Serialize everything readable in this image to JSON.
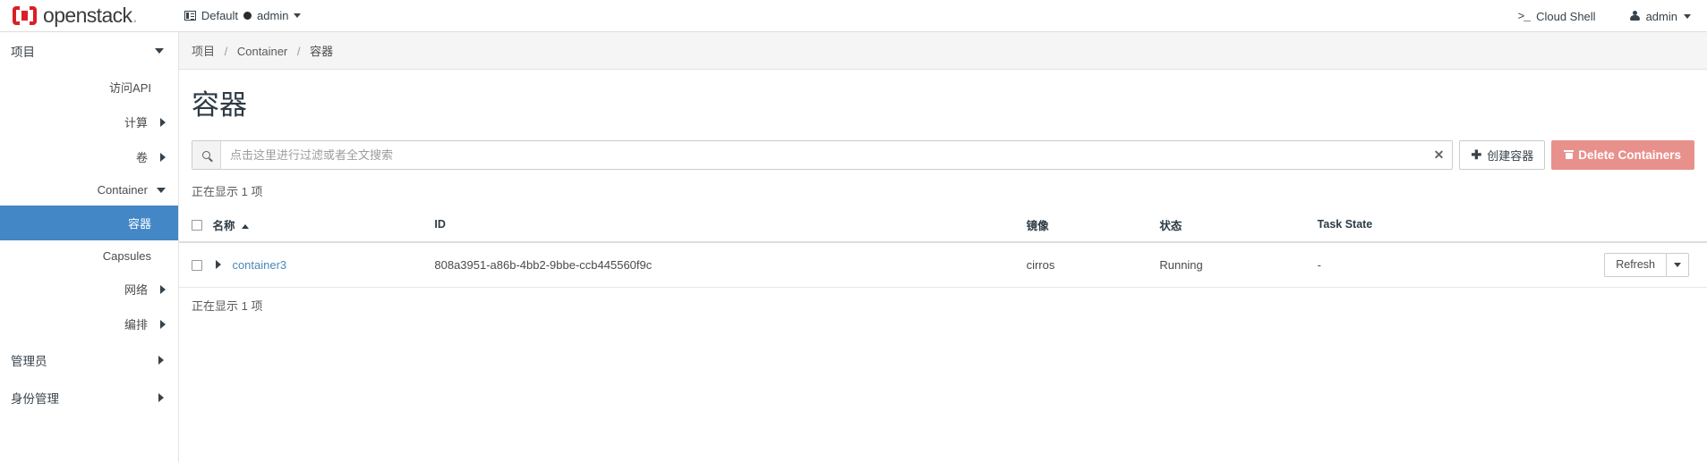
{
  "brand": {
    "word": "openstack",
    "dot": "."
  },
  "navbar": {
    "context": {
      "domain": "Default",
      "project": "admin",
      "icon": "list-icon"
    },
    "cloud_shell": {
      "label": "Cloud Shell",
      "icon": "terminal-prompt-icon",
      "glyph": ">_"
    },
    "user": {
      "label": "admin",
      "icon": "user-icon"
    }
  },
  "sidebar": {
    "sections": [
      {
        "label": "项目",
        "expanded": true,
        "items": [
          {
            "label": "访问API",
            "type": "leaf",
            "active": false
          },
          {
            "label": "计算",
            "type": "group",
            "expanded": false
          },
          {
            "label": "卷",
            "type": "group",
            "expanded": false
          },
          {
            "label": "Container",
            "type": "group",
            "expanded": true,
            "children": [
              {
                "label": "容器",
                "active": true
              },
              {
                "label": "Capsules",
                "active": false
              }
            ]
          },
          {
            "label": "网络",
            "type": "group",
            "expanded": false
          },
          {
            "label": "编排",
            "type": "group",
            "expanded": false
          }
        ]
      },
      {
        "label": "管理员",
        "expanded": false,
        "items": []
      },
      {
        "label": "身份管理",
        "expanded": false,
        "items": []
      }
    ]
  },
  "breadcrumb": {
    "items": [
      "项目",
      "Container",
      "容器"
    ],
    "separator": "/"
  },
  "page": {
    "title": "容器"
  },
  "toolbar": {
    "search": {
      "placeholder": "点击这里进行过滤或者全文搜索",
      "value": "",
      "icon": "search-icon",
      "clear_icon": "close-icon",
      "clear_glyph": "✕"
    },
    "create_button": {
      "label": "创建容器",
      "icon": "plus-icon",
      "glyph": "✚"
    },
    "delete_button": {
      "label": "Delete Containers",
      "icon": "trash-icon",
      "color": "#e8918c"
    }
  },
  "table": {
    "count_top": "正在显示 1 项",
    "count_bottom": "正在显示 1 项",
    "sort": {
      "column": "名称",
      "direction": "asc"
    },
    "columns": [
      "名称",
      "ID",
      "镜像",
      "状态",
      "Task State"
    ],
    "rows": [
      {
        "selected": false,
        "name": "container3",
        "id": "808a3951-a86b-4bb2-9bbe-ccb445560f9c",
        "image": "cirros",
        "status": "Running",
        "task_state": "-",
        "action": {
          "label": "Refresh",
          "caret_icon": "chevron-down-icon"
        }
      }
    ]
  },
  "colors": {
    "brand_red": "#da1f27",
    "active_blue": "#4387c7",
    "link_blue": "#4b88b8",
    "danger": "#e8918c"
  }
}
